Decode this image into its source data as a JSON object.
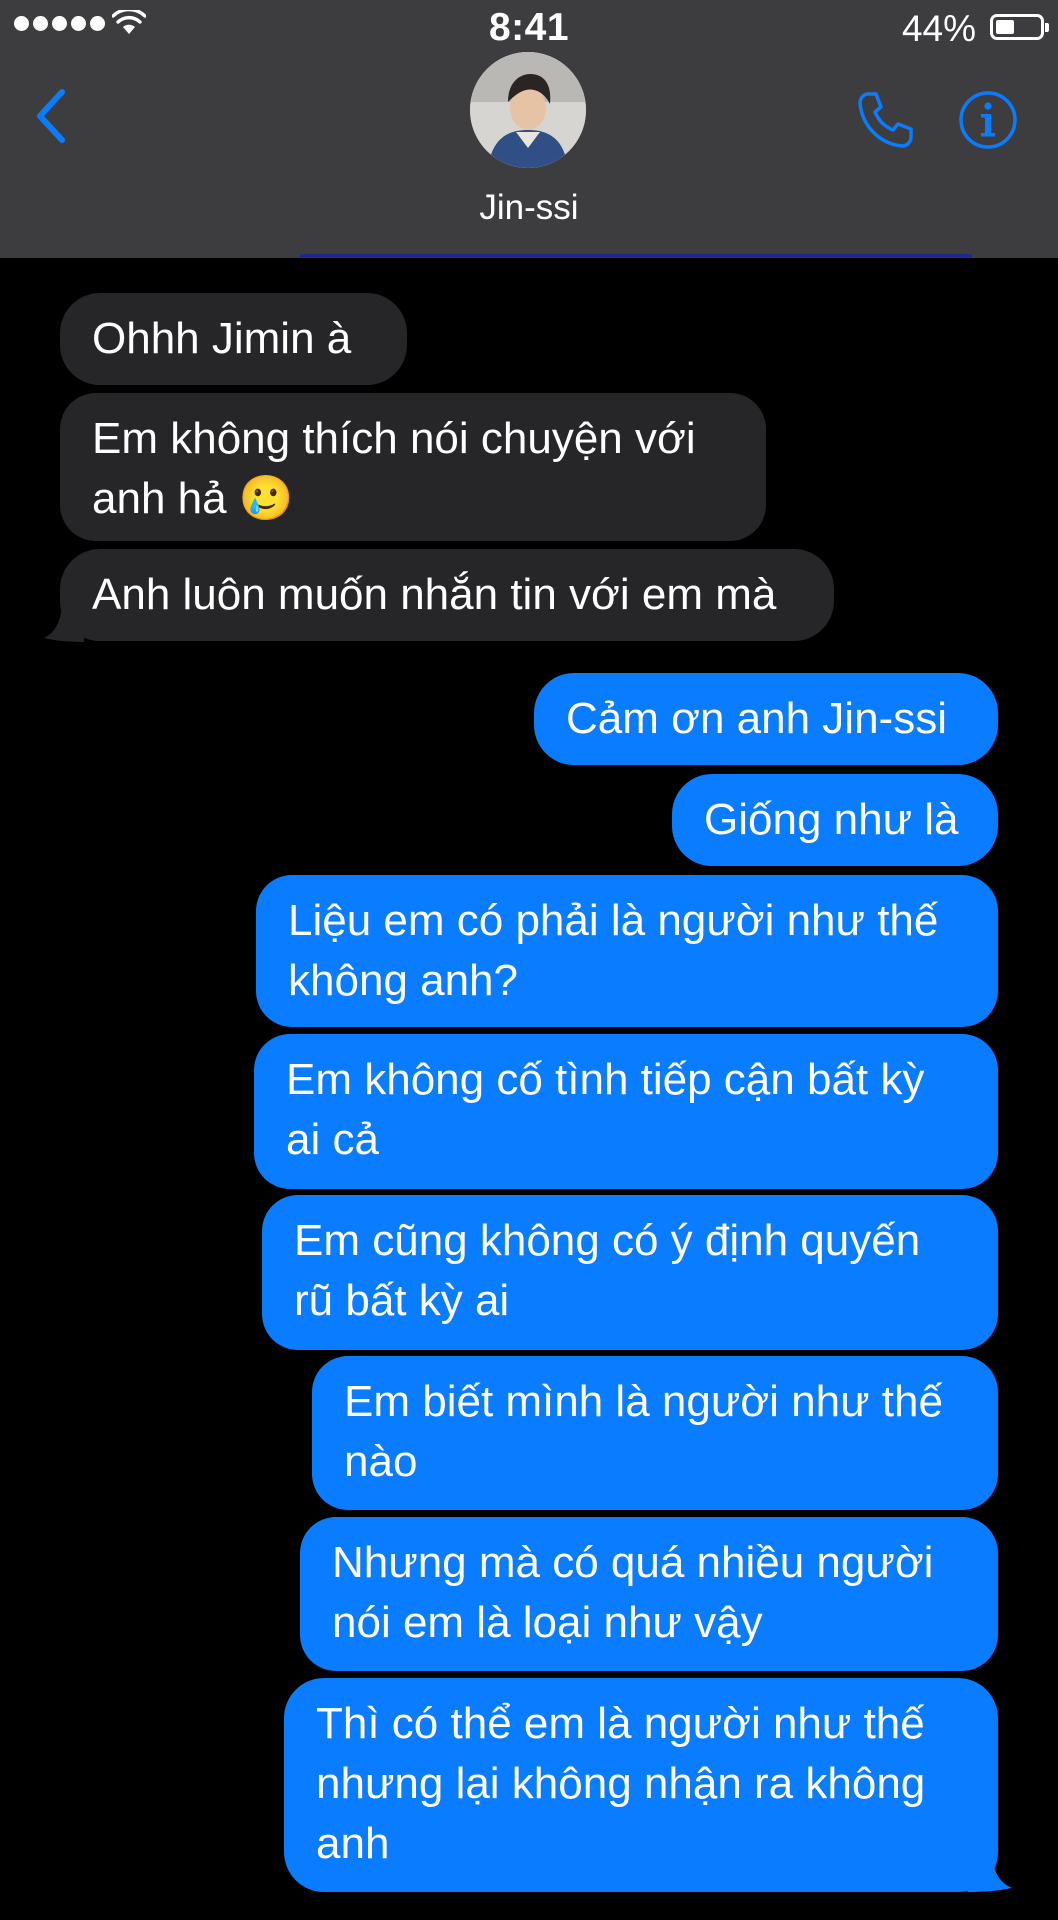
{
  "status_bar": {
    "time": "8:41",
    "battery_percent": "44%",
    "battery_level": 0.44,
    "signal_dots": 5
  },
  "header": {
    "contact_name": "Jin-ssi",
    "accent_color": "#0a7cff",
    "background_color": "#3d3d3f"
  },
  "icons": {
    "back": "chevron-left-icon",
    "phone": "phone-icon",
    "info": "info-icon",
    "wifi": "wifi-icon",
    "battery": "battery-icon"
  },
  "messages": [
    {
      "direction": "incoming",
      "text": "Ohhh Jimin à"
    },
    {
      "direction": "incoming",
      "text": "Em không thích nói chuyện với\nanh hả 🥲"
    },
    {
      "direction": "incoming",
      "text": "Anh luôn muốn nhắn tin với em mà"
    },
    {
      "direction": "outgoing",
      "text": "Cảm ơn anh Jin-ssi"
    },
    {
      "direction": "outgoing",
      "text": "Giống như là"
    },
    {
      "direction": "outgoing",
      "text": "Liệu em có phải là người như thế\nkhông anh?"
    },
    {
      "direction": "outgoing",
      "text": "Em không cố tình tiếp cận bất kỳ\nai cả"
    },
    {
      "direction": "outgoing",
      "text": "Em cũng không có ý định quyến\nrũ bất kỳ ai"
    },
    {
      "direction": "outgoing",
      "text": "Em biết mình là người như thế\nnào"
    },
    {
      "direction": "outgoing",
      "text": "Nhưng mà có quá nhiều người\nnói em là loại như vậy"
    },
    {
      "direction": "outgoing",
      "text": "Thì có thể em là người như thế\nnhưng lại không nhận ra không\nanh"
    }
  ],
  "colors": {
    "incoming_bubble": "#262628",
    "outgoing_bubble": "#0a7cff"
  }
}
